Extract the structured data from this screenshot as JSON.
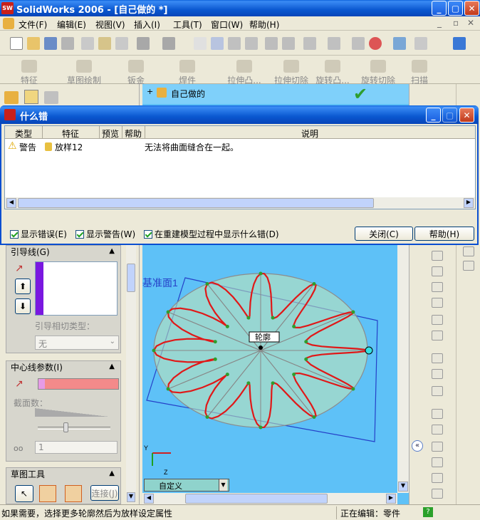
{
  "app": {
    "title": "SolidWorks 2006 - [自己做的 *]",
    "logo": "SW"
  },
  "menu": [
    "文件(F)",
    "编辑(E)",
    "视图(V)",
    "插入(I)",
    "工具(T)",
    "窗口(W)",
    "帮助(H)"
  ],
  "commands": [
    "特征",
    "草图绘制",
    "钣金",
    "焊件",
    "拉伸凸...",
    "拉伸切除",
    "旋转凸...",
    "旋转切除",
    "扫描"
  ],
  "tree": {
    "root_label": "自己做的"
  },
  "dialog": {
    "title": "什么错",
    "columns": [
      "类型",
      "特征",
      "预览",
      "帮助",
      "说明"
    ],
    "row": {
      "type": "警告",
      "feature": "放样12",
      "description": "无法将曲面缝合在一起。"
    },
    "checkboxes": [
      "显示错误(E)",
      "显示警告(W)",
      "在重建模型过程中显示什么错(D)"
    ],
    "close_label": "关闭(C)",
    "help_label": "帮助(H)"
  },
  "property": {
    "guide_title": "引导线(G)",
    "tangent_label": "引导相切类型：",
    "tangent_value": "无",
    "centerline_title": "中心线参数(I)",
    "section_label": "截面数：",
    "section_value": "1",
    "sketch_title": "草图工具",
    "connect_label": "连接(J)"
  },
  "viewport": {
    "plane_label": "基准面1",
    "profile_tag": "轮廓",
    "view_select": "自定义"
  },
  "status": {
    "left": "如果需要，选择更多轮廓然后为放样设定属性",
    "right": "正在编辑：零件",
    "help": "?"
  },
  "colors": {
    "accent": "#0a58d0",
    "viewport_bg": "#5ec1f7",
    "guide_purple": "#7a18e0",
    "centerline_pink": "#f48a8a"
  }
}
